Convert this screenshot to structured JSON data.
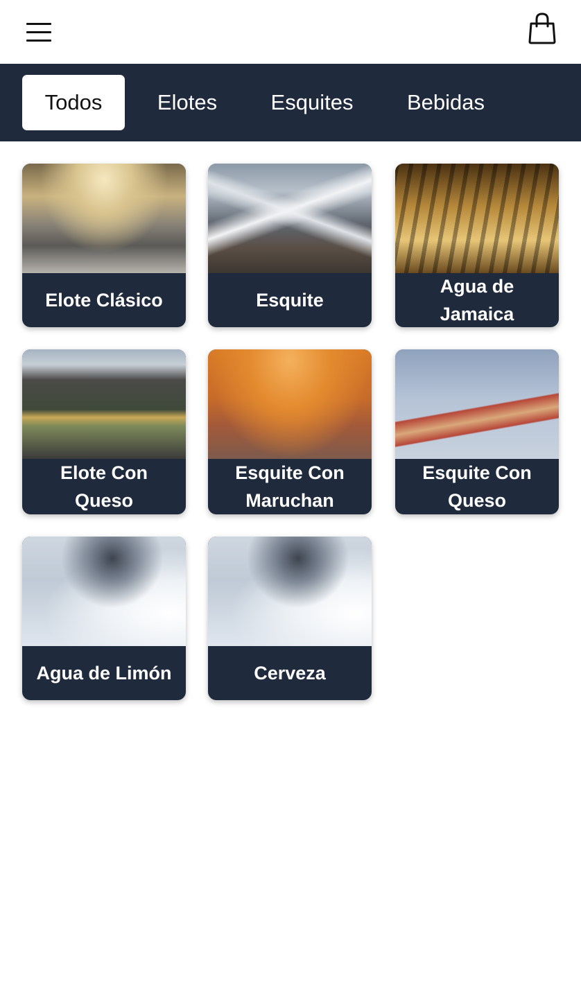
{
  "header": {
    "menu_icon": "hamburger-menu-icon",
    "cart_icon": "shopping-bag-icon"
  },
  "tabs": [
    {
      "label": "Todos",
      "active": true
    },
    {
      "label": "Elotes",
      "active": false
    },
    {
      "label": "Esquites",
      "active": false
    },
    {
      "label": "Bebidas",
      "active": false
    }
  ],
  "products": [
    {
      "name": "Elote Clásico",
      "image": "train-station-photo"
    },
    {
      "name": "Esquite",
      "image": "snowy-mountain-photo"
    },
    {
      "name": "Agua de Jamaica",
      "image": "amber-interior-photo"
    },
    {
      "name": "Elote Con Queso",
      "image": "mountain-road-photo"
    },
    {
      "name": "Esquite Con Maruchan",
      "image": "sunset-city-photo"
    },
    {
      "name": "Esquite Con Queso",
      "image": "motel-sign-photo"
    },
    {
      "name": "Agua de Limón",
      "image": "frosted-field-photo"
    },
    {
      "name": "Cerveza",
      "image": "frosted-field-photo"
    }
  ],
  "colors": {
    "nav_background": "#1f2a3c",
    "card_label_background": "#1f2a3c",
    "active_tab_background": "#ffffff"
  }
}
